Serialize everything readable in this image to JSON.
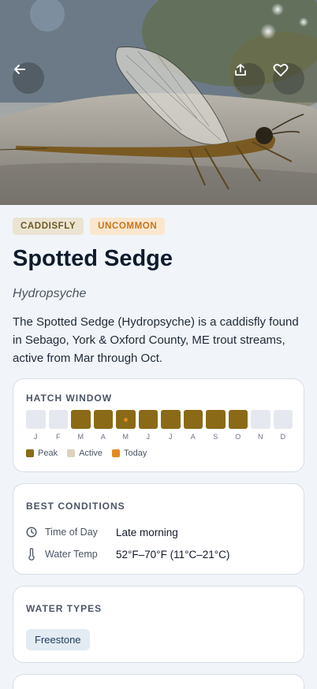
{
  "hero": {
    "image_alt": "Caddisfly perched on a rock",
    "back_icon": "arrow-left-icon",
    "share_icon": "share-icon",
    "favorite_icon": "heart-icon"
  },
  "badges": {
    "type": "CADDISFLY",
    "rarity": "UNCOMMON"
  },
  "title": "Spotted Sedge",
  "latin_name": "Hydropsyche",
  "description": "The Spotted Sedge (Hydropsyche) is a caddisfly found in Sebago, York & Oxford County, ME trout streams, active from Mar through Oct.",
  "hatch_window": {
    "title": "HATCH WINDOW",
    "months": [
      {
        "label": "J",
        "state": "none"
      },
      {
        "label": "F",
        "state": "none"
      },
      {
        "label": "M",
        "state": "peak"
      },
      {
        "label": "A",
        "state": "peak"
      },
      {
        "label": "M",
        "state": "peak",
        "today": true
      },
      {
        "label": "J",
        "state": "peak"
      },
      {
        "label": "J",
        "state": "peak"
      },
      {
        "label": "A",
        "state": "peak"
      },
      {
        "label": "S",
        "state": "peak"
      },
      {
        "label": "O",
        "state": "peak"
      },
      {
        "label": "N",
        "state": "none"
      },
      {
        "label": "D",
        "state": "none"
      }
    ],
    "legend": {
      "peak": "Peak",
      "active": "Active",
      "today": "Today"
    },
    "colors": {
      "peak": "#8a6a16",
      "active": "#ddd3bd",
      "today": "#e38b1f",
      "none": "#e5e9ef"
    }
  },
  "best_conditions": {
    "title": "BEST CONDITIONS",
    "time_of_day_label": "Time of Day",
    "time_of_day_value": "Late morning",
    "water_temp_label": "Water Temp",
    "water_temp_value": "52°F–70°F (11°C–21°C)"
  },
  "water_types": {
    "title": "WATER TYPES",
    "types": [
      "Freestone"
    ]
  }
}
